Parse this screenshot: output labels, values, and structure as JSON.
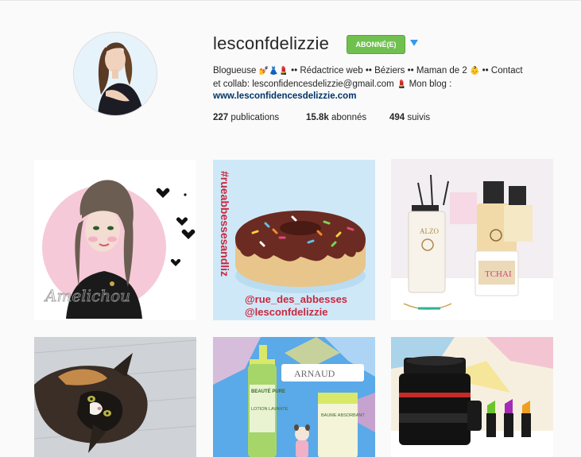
{
  "profile": {
    "username": "lesconfdelizzie",
    "follow_label": "Abonné(e)",
    "bio_line1_a": "Blogueuse",
    "bio_line1_b": "•• Rédactrice web •• Béziers •• Maman de 2",
    "bio_line1_c": "•• Contact",
    "bio_line2": "et collab: lesconfidencesdelizzie@gmail.com",
    "bio_line2_b": "Mon blog :",
    "website": "www.lesconfidencesdelizzie.com",
    "stats": {
      "posts_count": "227",
      "posts_label": "publications",
      "followers_count": "15.8k",
      "followers_label": "abonnés",
      "following_count": "494",
      "following_label": "suivis"
    }
  },
  "posts": [
    {
      "signature": "Amelichou"
    },
    {
      "caption_vertical": "#rueabbessesandliz",
      "caption_line1": "@rue_des_abbesses",
      "caption_line2": "@lesconfdelizzie"
    },
    {
      "label_brand": "ALZO",
      "label_candle": "TCHAI"
    },
    {},
    {
      "brand": "ARNAUD",
      "tube_left": "LOTION LAVANTE",
      "tube_right": "BAUME ABSORBANT",
      "tag": "BEAUTÉ PURE"
    },
    {}
  ],
  "colors": {
    "follow_green": "#70c050",
    "link_blue": "#003569",
    "arrow_blue": "#3897f0",
    "caption_red": "#c9283e"
  }
}
